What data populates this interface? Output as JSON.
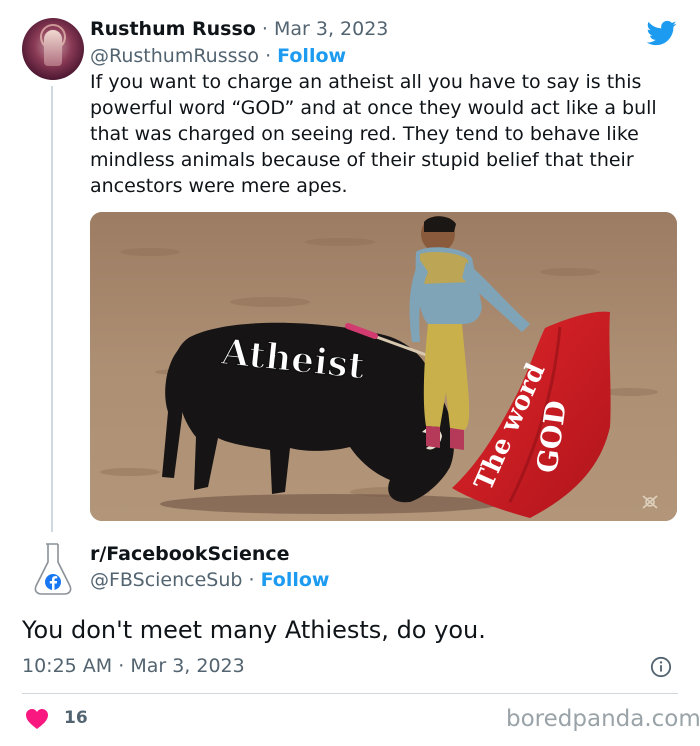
{
  "quoted_tweet": {
    "author_name": "Rusthum Russo",
    "separator": " · ",
    "date": "Mar 3, 2023",
    "handle": "@RusthumRussso",
    "handle_separator": " · ",
    "follow_label": "Follow",
    "text": "If you want to charge an atheist all you have to say is this powerful word “GOD” and at once they would act like a bull that was charged on seeing red. They tend to behave like mindless animals because of their stupid belief that their ancestors were mere apes.",
    "image": {
      "bull_label": "Atheist",
      "cape_label_line1": "The word",
      "cape_label_line2": "GOD"
    }
  },
  "main_tweet": {
    "author_name": "r/FacebookScience",
    "handle": "@FBScienceSub",
    "handle_separator": " · ",
    "follow_label": "Follow",
    "text": "You don't meet many Athiests, do you.",
    "time": "10:25 AM",
    "meta_separator": " · ",
    "date": "Mar 3, 2023",
    "like_count": "16"
  },
  "watermark": "boredpanda.com",
  "icons": {
    "brand": "twitter-bird-icon",
    "info": "info-icon",
    "like": "heart-icon",
    "avatar_badge": "facebook-icon"
  },
  "colors": {
    "link_blue": "#1d9bf0",
    "secondary_text": "#536471",
    "like_red": "#f91880",
    "divider": "#cfd9de"
  }
}
